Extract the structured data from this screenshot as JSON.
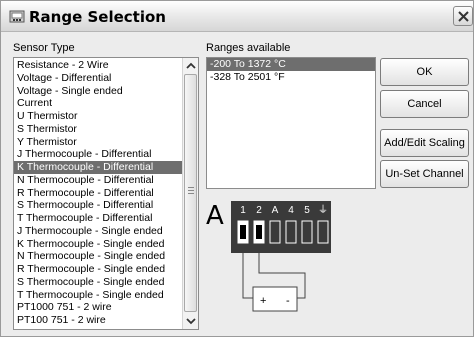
{
  "window": {
    "title": "Range Selection"
  },
  "sensor_type": {
    "label": "Sensor Type",
    "items": [
      "Resistance - 2 Wire",
      "Voltage - Differential",
      "Voltage - Single ended",
      "Current",
      "U  Thermistor",
      "S  Thermistor",
      "Y  Thermistor",
      "J Thermocouple - Differential",
      "K Thermocouple - Differential",
      "N Thermocouple - Differential",
      "R Thermocouple - Differential",
      "S Thermocouple - Differential",
      "T Thermocouple - Differential",
      "J Thermocouple - Single ended",
      "K Thermocouple - Single ended",
      "N Thermocouple - Single ended",
      "R Thermocouple - Single ended",
      "S Thermocouple - Single ended",
      "T Thermocouple - Single ended",
      "PT1000 751 - 2 wire",
      "PT100 751 - 2 wire"
    ],
    "selected_index": 8
  },
  "ranges": {
    "label": "Ranges available",
    "items": [
      "-200 To 1372 °C",
      "-328 To 2501 °F"
    ],
    "selected_index": 0
  },
  "buttons": {
    "ok": "OK",
    "cancel": "Cancel",
    "add_edit_scaling": "Add/Edit Scaling",
    "unset_channel": "Un-Set Channel"
  },
  "diagram": {
    "connector_letter": "A",
    "terminal_labels": [
      "1",
      "2",
      "A",
      "4",
      "5",
      "⏚"
    ],
    "plus": "+",
    "minus": "-"
  },
  "colors": {
    "selection": "#6e6e6e",
    "terminal_block": "#3a3a3a"
  }
}
